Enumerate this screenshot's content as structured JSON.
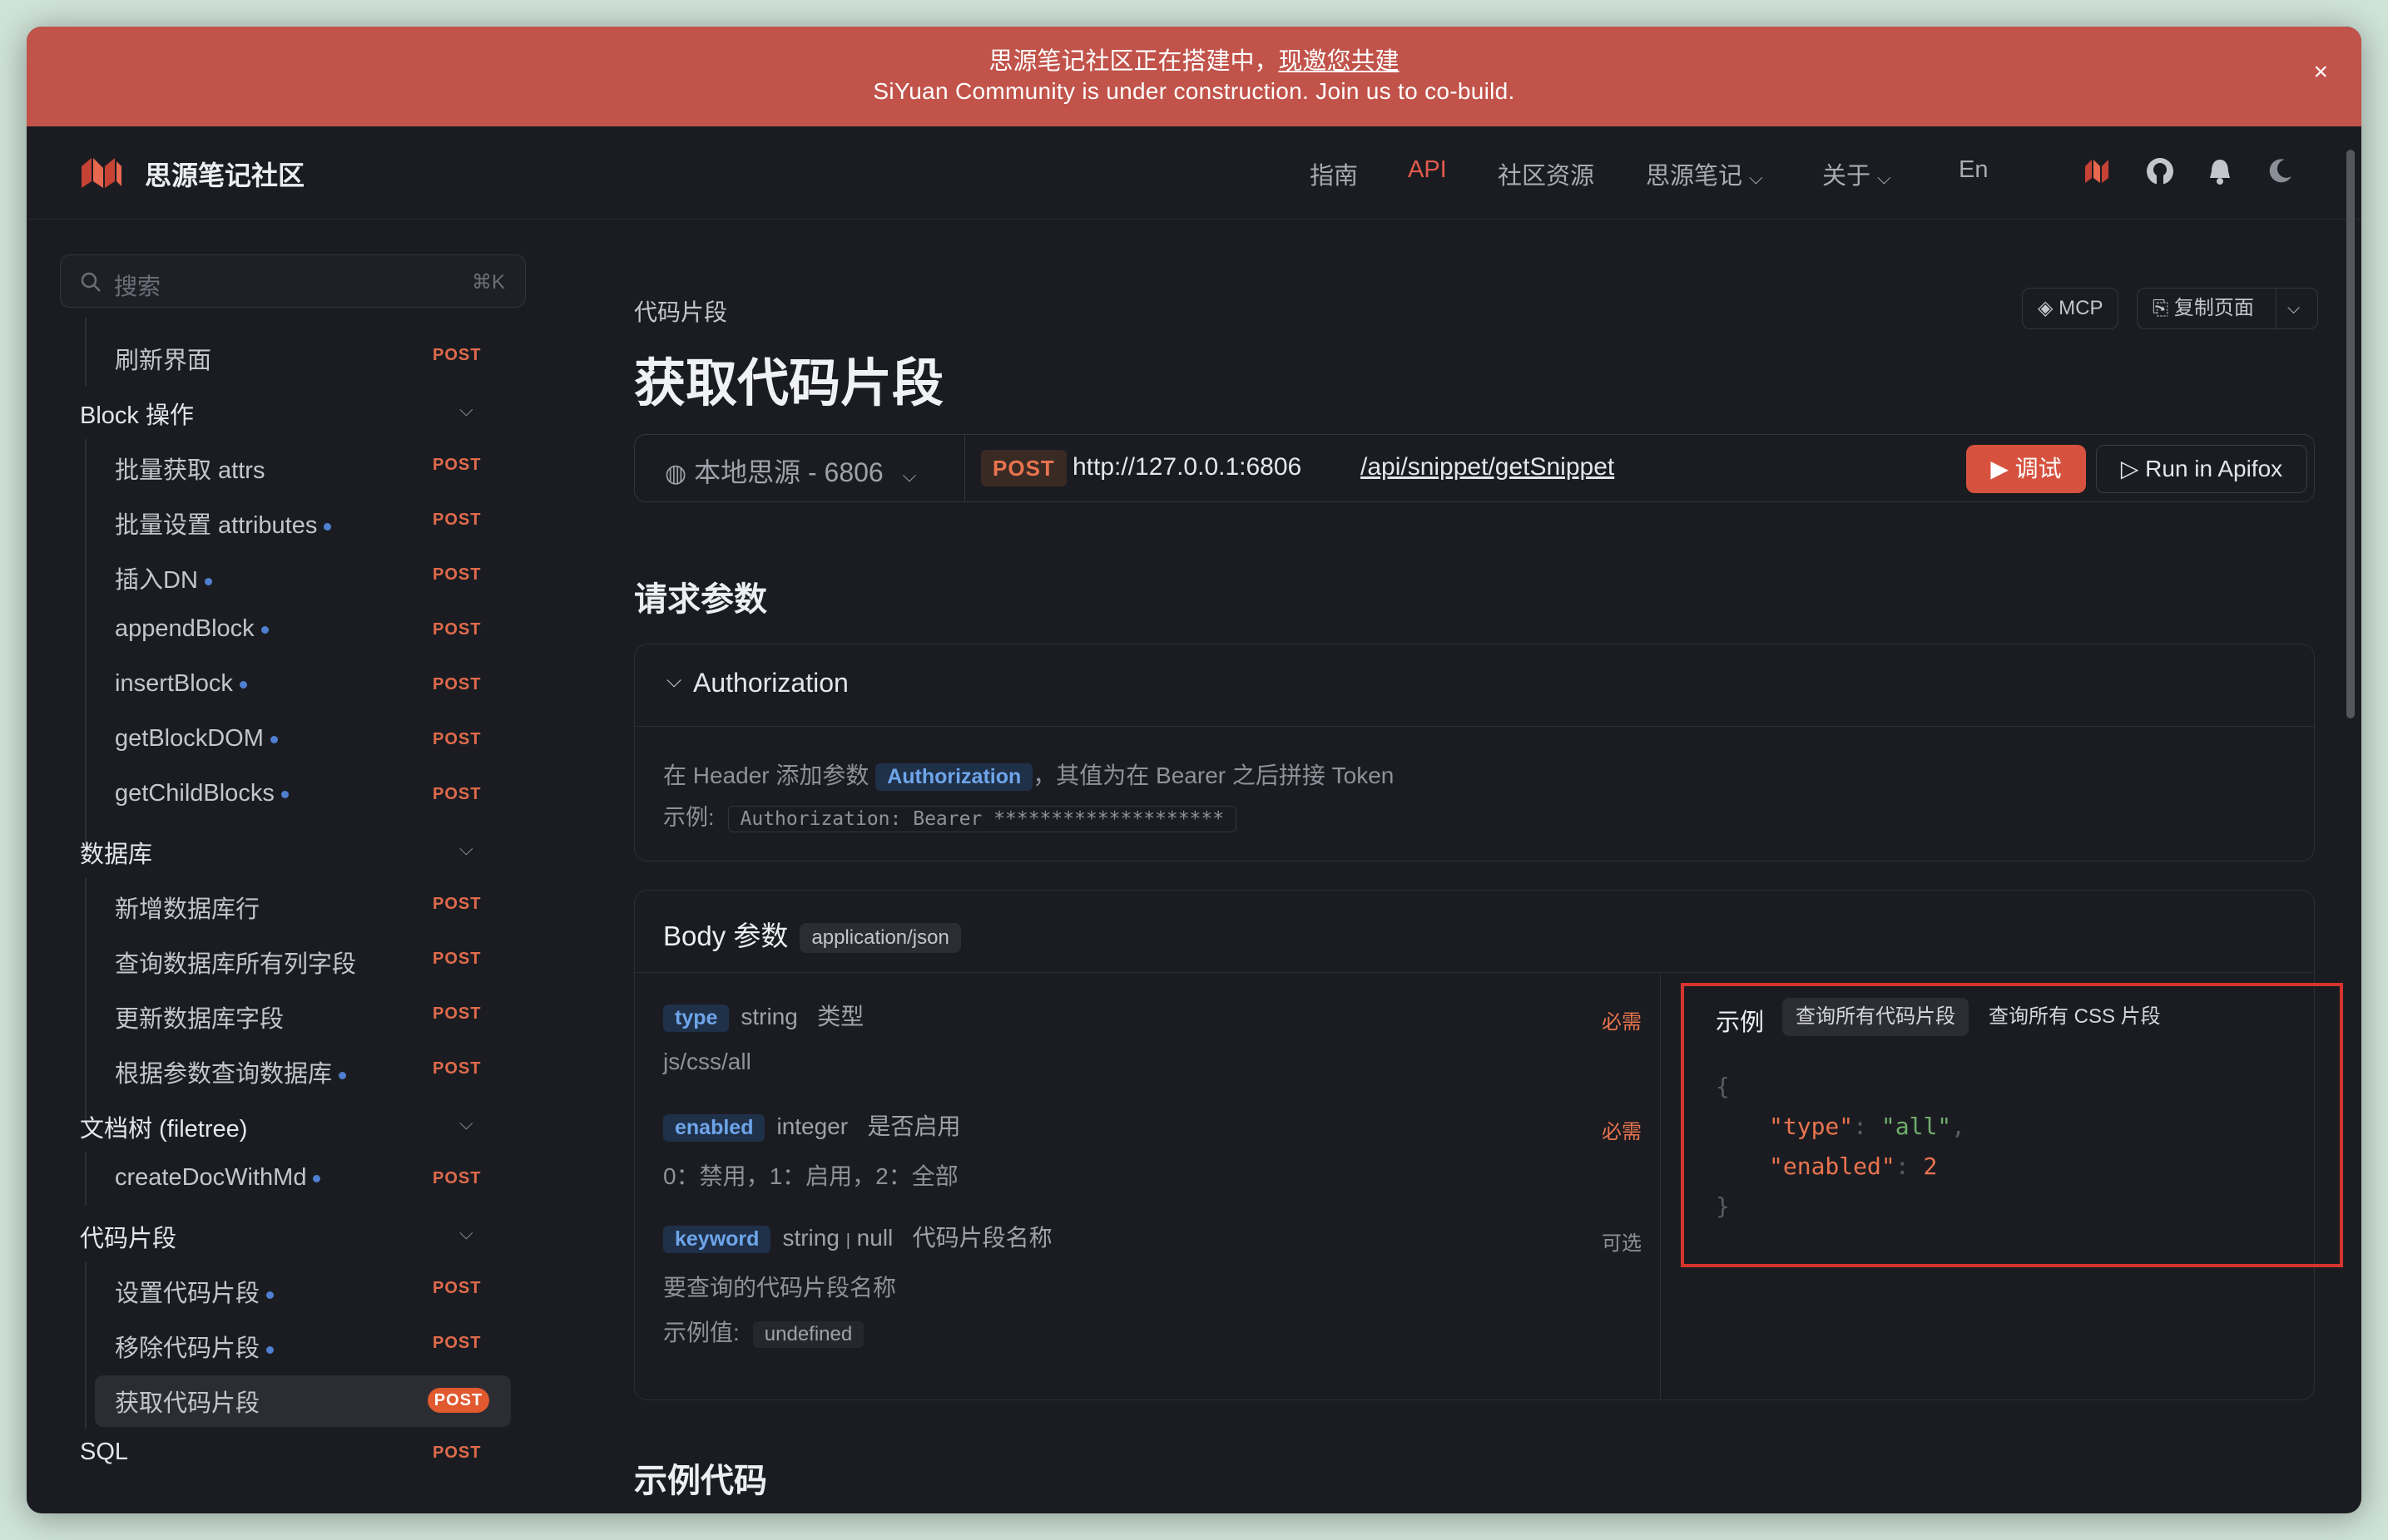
{
  "banner": {
    "line1": "思源笔记社区正在搭建中，",
    "line1_link": "现邀您共建",
    "line2": "SiYuan Community is under construction. Join us to co-build.",
    "close": "×"
  },
  "header": {
    "brand": "思源笔记社区",
    "nav": [
      {
        "label": "指南"
      },
      {
        "label": "API"
      },
      {
        "label": "社区资源"
      },
      {
        "label": "思源笔记"
      },
      {
        "label": "关于"
      },
      {
        "label": "En"
      }
    ],
    "icons": [
      "siyuan-icon",
      "github-icon",
      "bell-icon",
      "moon-icon"
    ]
  },
  "sidebar": {
    "search_placeholder": "搜索",
    "search_shortcut": "⌘K",
    "items": [
      {
        "label": "刷新界面",
        "badge": "POST"
      },
      {
        "group": "Block 操作"
      },
      {
        "label": "批量获取 attrs",
        "badge": "POST"
      },
      {
        "label": "批量设置 attributes",
        "badge": "POST"
      },
      {
        "label": "插入DN",
        "badge": "POST"
      },
      {
        "label": "appendBlock",
        "badge": "POST"
      },
      {
        "label": "insertBlock",
        "badge": "POST"
      },
      {
        "label": "getBlockDOM",
        "badge": "POST"
      },
      {
        "label": "getChildBlocks",
        "badge": "POST"
      },
      {
        "group": "数据库"
      },
      {
        "label": "新增数据库行",
        "badge": "POST"
      },
      {
        "label": "查询数据库所有列字段",
        "badge": "POST"
      },
      {
        "label": "更新数据库字段",
        "badge": "POST"
      },
      {
        "label": "根据参数查询数据库",
        "badge": "POST"
      },
      {
        "group": "文档树 (filetree)"
      },
      {
        "label": "createDocWithMd",
        "badge": "POST"
      },
      {
        "group": "代码片段"
      },
      {
        "label": "设置代码片段",
        "badge": "POST"
      },
      {
        "label": "移除代码片段",
        "badge": "POST"
      },
      {
        "label": "获取代码片段",
        "badge": "POST"
      },
      {
        "group": "SQL",
        "badge": "POST"
      }
    ]
  },
  "main": {
    "breadcrumb": "代码片段",
    "title": "获取代码片段",
    "mcp": "MCP",
    "copy_page": "复制页面",
    "env": "本地思源 - 6806",
    "method": "POST",
    "host": "http://127.0.0.1:6806",
    "path": "/api/snippet/getSnippet",
    "debug": "调试",
    "apifox": "Run in Apifox",
    "request_params": "请求参数",
    "auth": {
      "title": "Authorization",
      "desc_pre": "在 Header 添加参数",
      "chip": "Authorization",
      "desc_post": "，其值为在 Bearer 之后拼接 Token",
      "example_label": "示例:",
      "example_code": "Authorization: Bearer ********************"
    },
    "body": {
      "title": "Body 参数",
      "mime": "application/json",
      "params": [
        {
          "name": "type",
          "type": "string",
          "label": "类型",
          "req": "必需",
          "desc": "js/css/all"
        },
        {
          "name": "enabled",
          "type": "integer",
          "label": "是否启用",
          "req": "必需",
          "desc": "0：禁用，1：启用，2：全部"
        },
        {
          "name": "keyword",
          "type": "string",
          "type2": "null",
          "label": "代码片段名称",
          "req": "可选",
          "desc": "要查询的代码片段名称",
          "example_label": "示例值:",
          "example_value": "undefined"
        }
      ],
      "example": {
        "title": "示例",
        "tabs": [
          "查询所有代码片段",
          "查询所有 CSS 片段"
        ],
        "open": "{",
        "k1": "\"type\"",
        "v1": "\"all\"",
        "k2": "\"enabled\"",
        "v2": "2",
        "close": "}"
      }
    },
    "example_code": "示例代码"
  },
  "colors": {
    "accent": "#e15a4e",
    "banner": "#c1534a",
    "highlight": "#d7342e"
  }
}
